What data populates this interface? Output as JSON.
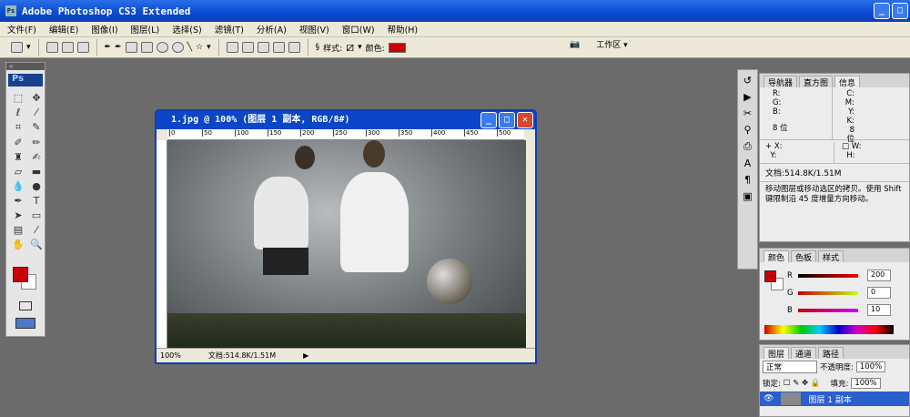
{
  "app": {
    "title": "Adobe Photoshop CS3 Extended",
    "logo": "Ps"
  },
  "menu": [
    "文件(F)",
    "编辑(E)",
    "图像(I)",
    "图层(L)",
    "选择(S)",
    "滤镜(T)",
    "分析(A)",
    "视图(V)",
    "窗口(W)",
    "帮助(H)"
  ],
  "options": {
    "style_label": "样式:",
    "color_label": "颜色:",
    "color": "#c8000a",
    "workspace": "工作区 ▾"
  },
  "document": {
    "title": "1.jpg @ 100% (图层 1 副本, RGB/8#)",
    "ruler": [
      "0",
      "50",
      "100",
      "150",
      "200",
      "250",
      "300",
      "350",
      "400",
      "450",
      "500"
    ],
    "zoom": "100%",
    "doc_size": "文档:514.8K/1.51M"
  },
  "info_panel": {
    "tabs": [
      "导航器",
      "直方图",
      "信息"
    ],
    "rgb": [
      "R:",
      "G:",
      "B:"
    ],
    "cmyk": [
      "C:",
      "M:",
      "Y:",
      "K:"
    ],
    "bits_left": "8 位",
    "bits_right": "8 位",
    "xy": [
      "X:",
      "Y:"
    ],
    "wh": [
      "W:",
      "H:"
    ],
    "doc": "文档:514.8K/1.51M",
    "hint": "移动图层或移动选区的拷贝。使用 Shift 键限制沿 45 度增量方向移动。"
  },
  "color_panel": {
    "tabs": [
      "颜色",
      "色板",
      "样式"
    ],
    "channels": [
      {
        "label": "R",
        "value": "200"
      },
      {
        "label": "G",
        "value": "0"
      },
      {
        "label": "B",
        "value": "10"
      }
    ]
  },
  "layers_panel": {
    "tabs": [
      "图层",
      "通道",
      "路径"
    ],
    "blend": "正常",
    "opacity_label": "不透明度:",
    "opacity": "100%",
    "lock_label": "锁定:",
    "fill_label": "填充:",
    "fill": "100%",
    "layer_name": "图层 1 副本"
  }
}
